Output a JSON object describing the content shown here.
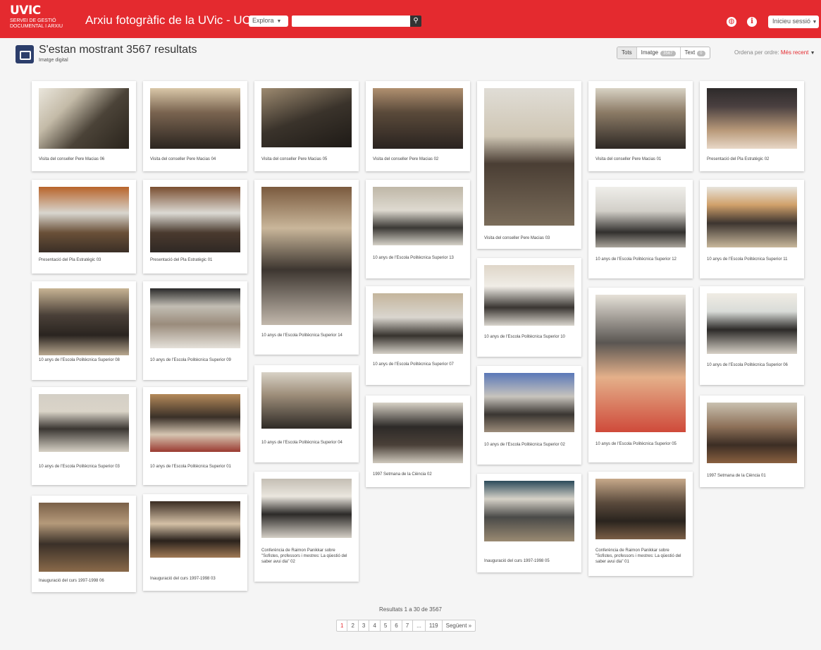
{
  "header": {
    "logo_main": "UVIC",
    "logo_sub1": "SERVEI DE GESTIÓ",
    "logo_sub2": "DOCUMENTAL I ARXIU",
    "site_title": "Arxiu fotogràfic de la UVic - UCC",
    "explore_label": "Explora",
    "search_placeholder": "",
    "login_label": "Inicieu sessió"
  },
  "results": {
    "title": "S'estan mostrant 3567 resultats",
    "subtitle": "Imatge digital"
  },
  "filters": {
    "all_label": "Tots",
    "image_label": "Imatge",
    "image_count": "3567",
    "text_label": "Text",
    "text_count": "0"
  },
  "sort": {
    "label": "Ordena per ordre:",
    "value": "Més recent"
  },
  "items": [
    "Visita del conseller Pere Macias 06",
    "Visita del conseller Pere Macias 04",
    "Visita del conseller Pere Macias 05",
    "Visita del conseller Pere Macias 02",
    "Visita del conseller Pere Macias 03",
    "Visita del conseller Pere Macias 01",
    "Presentació del Pla Estratègic 02",
    "Presentació del Pla Estratègic 03",
    "Presentació del Pla Estratègic 01",
    "10 anys de l'Escola Politècnica Superior 14",
    "10 anys de l'Escola Politècnica Superior 13",
    "10 anys de l'Escola Politècnica Superior 12",
    "10 anys de l'Escola Politècnica Superior 11",
    "10 anys de l'Escola Politècnica Superior 08",
    "10 anys de l'Escola Politècnica Superior 09",
    "10 anys de l'Escola Politècnica Superior 07",
    "10 anys de l'Escola Politècnica Superior 10",
    "10 anys de l'Escola Politècnica Superior 05",
    "10 anys de l'Escola Politècnica Superior 06",
    "10 anys de l'Escola Politècnica Superior 03",
    "10 anys de l'Escola Politècnica Superior 01",
    "10 anys de l'Escola Politècnica Superior 04",
    "1997 Setmana de la Ciència 02",
    "10 anys de l'Escola Politècnica Superior 02",
    "1997 Setmana de la Ciència 01",
    "Inauguració del curs 1997-1998 06",
    "Inauguració del curs 1997-1998 03",
    "Conferència de Raimon Panikkar sobre \"Sofistes, professors i mestres: La qüestió del saber avui dia\" 02",
    "Inauguració del curs 1997-1998 05",
    "Conferència de Raimon Panikkar sobre \"Sofistes, professors i mestres: La qüestió del saber avui dia\" 01"
  ],
  "pagination": {
    "summary": "Resultats 1 a 30 de 3567",
    "pages": [
      "1",
      "2",
      "3",
      "4",
      "5",
      "6",
      "7",
      "...",
      "119"
    ],
    "next_label": "Següent »"
  }
}
